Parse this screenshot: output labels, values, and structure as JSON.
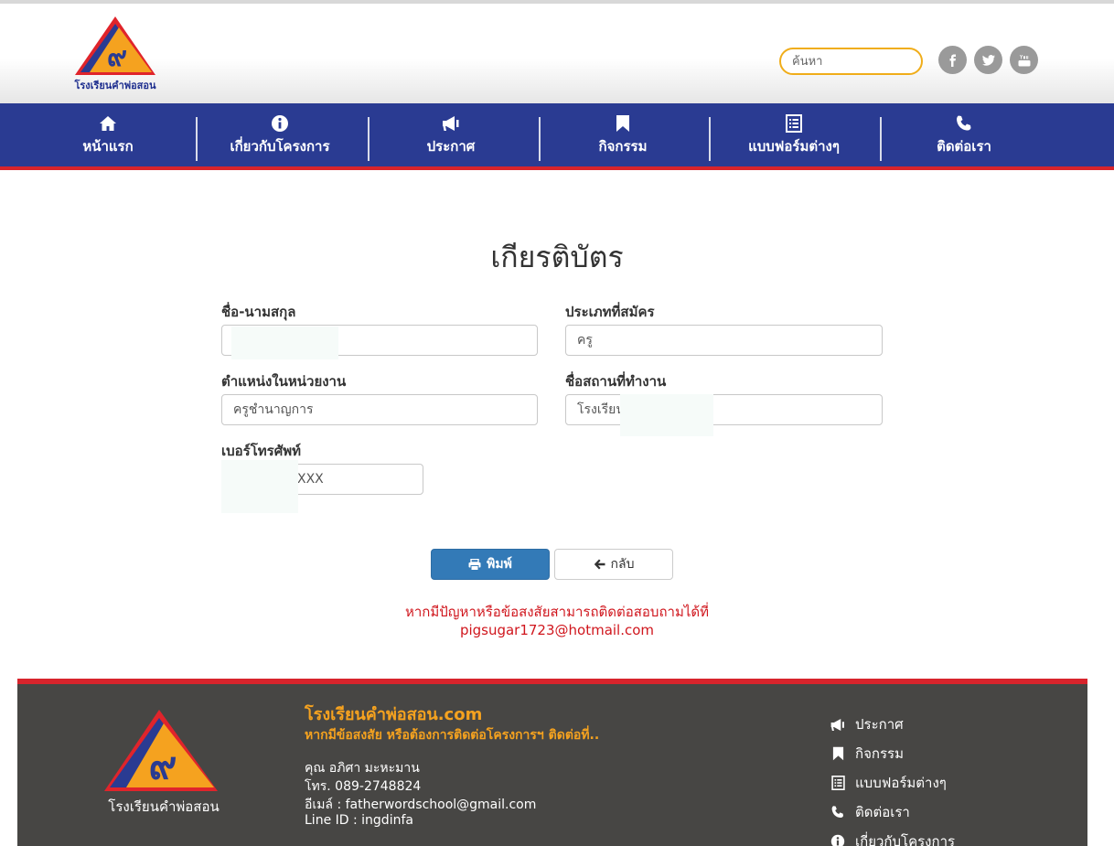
{
  "header": {
    "logo_text": "โรงเรียนคำพ่อสอน",
    "search_placeholder": "ค้นหา",
    "social": [
      {
        "icon": "facebook-icon"
      },
      {
        "icon": "twitter-icon"
      },
      {
        "icon": "youtube-icon"
      }
    ]
  },
  "nav": {
    "items": [
      {
        "label": "หน้าแรก",
        "icon": "home-icon"
      },
      {
        "label": "เกี่ยวกับโครงการ",
        "icon": "info-icon"
      },
      {
        "label": "ประกาศ",
        "icon": "megaphone-icon"
      },
      {
        "label": "กิจกรรม",
        "icon": "bookmark-icon"
      },
      {
        "label": "แบบฟอร์มต่างๆ",
        "icon": "list-icon"
      },
      {
        "label": "ติดต่อเรา",
        "icon": "phone-icon"
      }
    ]
  },
  "main": {
    "title": "เกียรติบัตร",
    "fields": {
      "fullname": {
        "label": "ชื่อ-นามสกุล",
        "value": ""
      },
      "applicant_type": {
        "label": "ประเภทที่สมัคร",
        "value": "ครู"
      },
      "position": {
        "label": "ตำแหน่งในหน่วยงาน",
        "value": "ครูชำนาญการ"
      },
      "workplace": {
        "label": "ชื่อสถานที่ทำงาน",
        "value": "โรงเรียน"
      },
      "phone": {
        "label": "เบอร์โทรศัพท์",
        "value": "XXX"
      }
    },
    "print_label": "พิมพ์",
    "back_label": "กลับ",
    "notice_line1": "หากมีปัญหาหรือข้อสงสัยสามารถติดต่อสอบถามได้ที่",
    "notice_line2": "pigsugar1723@hotmail.com"
  },
  "footer": {
    "logo_text": "โรงเรียนคำพ่อสอน",
    "site_name": "โรงเรียนคำพ่อสอน.com",
    "tagline": "หากมีข้อสงสัย หรือต้องการติดต่อโครงการฯ ติดต่อที่..",
    "contact_name": "คุณ อภิศา มะหะมาน",
    "contact_phone": "โทร. 089-2748824",
    "contact_email": "อีเมล์ : fatherwordschool@gmail.com",
    "contact_line": "Line ID : ingdinfa",
    "links": [
      {
        "label": "ประกาศ",
        "icon": "megaphone-icon"
      },
      {
        "label": "กิจกรรม",
        "icon": "bookmark-icon"
      },
      {
        "label": "แบบฟอร์มต่างๆ",
        "icon": "list-icon"
      },
      {
        "label": "ติดต่อเรา",
        "icon": "phone-icon"
      },
      {
        "label": "เกี่ยวกับโครงการ",
        "icon": "info-icon"
      }
    ]
  },
  "colors": {
    "nav_blue": "#2a3b92",
    "accent_red": "#d8242c",
    "logo_orange": "#f5a21f",
    "print_blue": "#337ab7",
    "footer_bg": "#474644"
  }
}
